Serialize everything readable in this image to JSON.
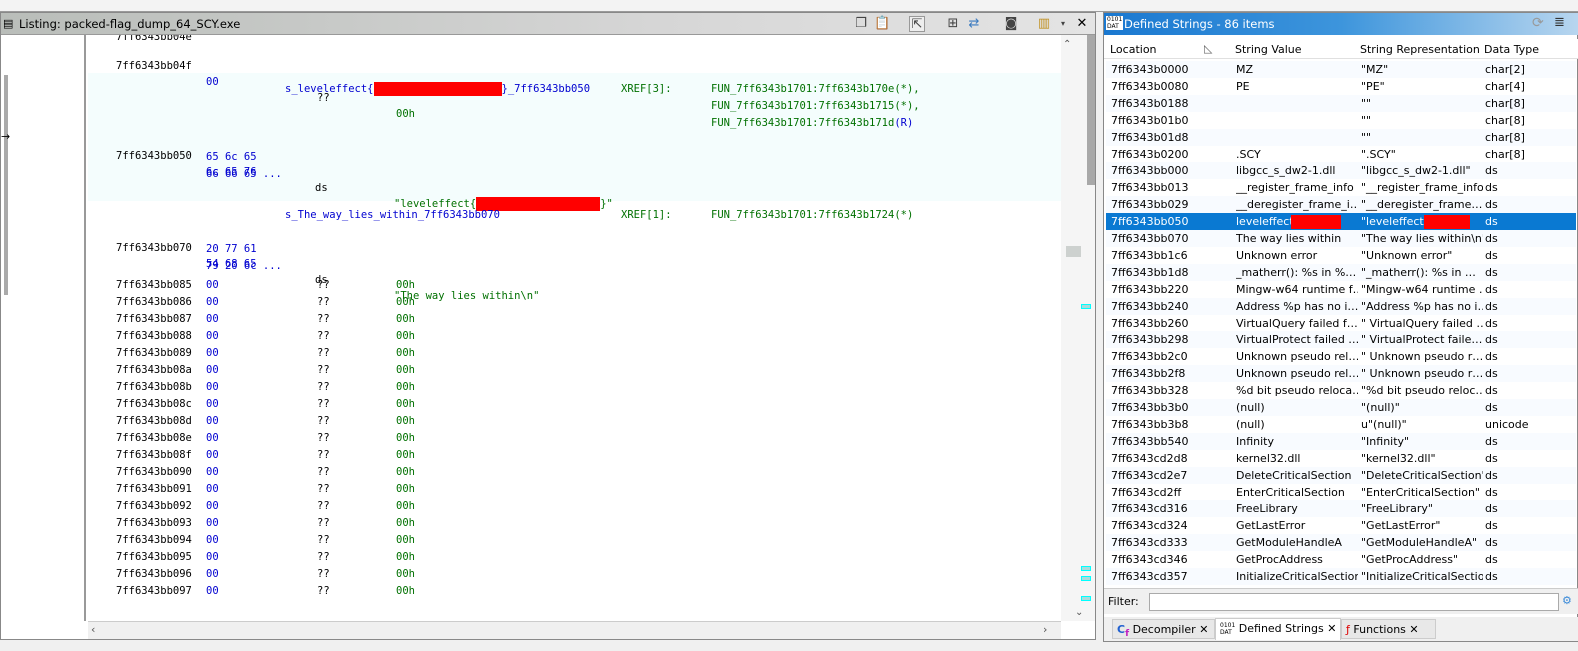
{
  "listing": {
    "title": "Listing:  packed-flag_dump_64_SCY.exe",
    "top_row": {
      "address": "7ff6343bb04f",
      "bytes": "00",
      "mnemonic": "??",
      "operand": "00h"
    },
    "label1": {
      "prefix": "s_leveleffect{",
      "suffix": "}_7ff6343bb050",
      "xref": "XREF[3]:",
      "refs": [
        "FUN_7ff6343b1701:7ff6343b170e(*),",
        "FUN_7ff6343b1701:7ff6343b1715(*),",
        "FUN_7ff6343b1701:7ff6343b171d"
      ],
      "last_ref_flag": "(R)"
    },
    "data1": {
      "address": "7ff6343bb050",
      "bytes": [
        "6c 65 76",
        "65 6c 65",
        "66 66 65 ..."
      ],
      "mnemonic": "ds",
      "operand_prefix": "\"leveleffect{",
      "operand_suffix": "}\""
    },
    "label2": {
      "name": "s_The_way_lies_within_7ff6343bb070",
      "xref": "XREF[1]:",
      "ref": "FUN_7ff6343b1701:7ff6343b1724(*)"
    },
    "data2": {
      "address": "7ff6343bb070",
      "bytes": [
        "54 68 65",
        "20 77 61",
        "79 20 6c ..."
      ],
      "mnemonic": "ds",
      "operand": "\"The way lies within\\n\""
    },
    "undefined_rows": [
      "7ff6343bb085",
      "7ff6343bb086",
      "7ff6343bb087",
      "7ff6343bb088",
      "7ff6343bb089",
      "7ff6343bb08a",
      "7ff6343bb08b",
      "7ff6343bb08c",
      "7ff6343bb08d",
      "7ff6343bb08e",
      "7ff6343bb08f",
      "7ff6343bb090",
      "7ff6343bb091",
      "7ff6343bb092",
      "7ff6343bb093",
      "7ff6343bb094",
      "7ff6343bb095",
      "7ff6343bb096",
      "7ff6343bb097"
    ],
    "undefined_bytes": "00",
    "undefined_mnemonic": "??",
    "undefined_operand": "00h"
  },
  "strings": {
    "title": "Defined Strings - 86 items",
    "columns": [
      "Location",
      "String Value",
      "String Representation",
      "Data Type"
    ],
    "rows": [
      [
        "7ff6343b0000",
        "MZ",
        "\"MZ\"",
        "char[2]"
      ],
      [
        "7ff6343b0080",
        "PE",
        "\"PE\"",
        "char[4]"
      ],
      [
        "7ff6343b0188",
        "",
        "\"\"",
        "char[8]"
      ],
      [
        "7ff6343b01b0",
        "",
        "\"\"",
        "char[8]"
      ],
      [
        "7ff6343b01d8",
        "",
        "\"\"",
        "char[8]"
      ],
      [
        "7ff6343b0200",
        ".SCY",
        "\".SCY\"",
        "char[8]"
      ],
      [
        "7ff6343bb000",
        "libgcc_s_dw2-1.dll",
        "\"libgcc_s_dw2-1.dll\"",
        "ds"
      ],
      [
        "7ff6343bb013",
        "__register_frame_info",
        "\"__register_frame_info\"",
        "ds"
      ],
      [
        "7ff6343bb029",
        "__deregister_frame_i…",
        "\"__deregister_frame…",
        "ds"
      ],
      [
        "7ff6343bb050",
        "leveleffect{",
        "\"leveleffect{",
        "ds"
      ],
      [
        "7ff6343bb070",
        "The way lies within",
        "\"The way lies within\\n\"",
        "ds"
      ],
      [
        "7ff6343bb1c6",
        "Unknown error",
        "\"Unknown error\"",
        "ds"
      ],
      [
        "7ff6343bb1d8",
        "_matherr(): %s in %…",
        "\"_matherr(): %s in …",
        "ds"
      ],
      [
        "7ff6343bb220",
        "Mingw-w64 runtime f…",
        "\"Mingw-w64 runtime …",
        "ds"
      ],
      [
        "7ff6343bb240",
        "Address %p has no i…",
        "\"Address %p has no i…",
        "ds"
      ],
      [
        "7ff6343bb260",
        "  VirtualQuery failed f…",
        "\"  VirtualQuery failed …",
        "ds"
      ],
      [
        "7ff6343bb298",
        "  VirtualProtect failed …",
        "\"  VirtualProtect faile…",
        "ds"
      ],
      [
        "7ff6343bb2c0",
        "  Unknown pseudo rel…",
        "\"  Unknown pseudo r…",
        "ds"
      ],
      [
        "7ff6343bb2f8",
        "  Unknown pseudo rel…",
        "\"  Unknown pseudo r…",
        "ds"
      ],
      [
        "7ff6343bb328",
        "%d bit pseudo reloca…",
        "\"%d bit pseudo reloc…",
        "ds"
      ],
      [
        "7ff6343bb3b0",
        "(null)",
        "\"(null)\"",
        "ds"
      ],
      [
        "7ff6343bb3b8",
        "(null)",
        "u\"(null)\"",
        "unicode"
      ],
      [
        "7ff6343bb540",
        "Infinity",
        "\"Infinity\"",
        "ds"
      ],
      [
        "7ff6343cd2d8",
        "kernel32.dll",
        "\"kernel32.dll\"",
        "ds"
      ],
      [
        "7ff6343cd2e7",
        "DeleteCriticalSection",
        "\"DeleteCriticalSection\"",
        "ds"
      ],
      [
        "7ff6343cd2ff",
        "EnterCriticalSection",
        "\"EnterCriticalSection\"",
        "ds"
      ],
      [
        "7ff6343cd316",
        "FreeLibrary",
        "\"FreeLibrary\"",
        "ds"
      ],
      [
        "7ff6343cd324",
        "GetLastError",
        "\"GetLastError\"",
        "ds"
      ],
      [
        "7ff6343cd333",
        "GetModuleHandleA",
        "\"GetModuleHandleA\"",
        "ds"
      ],
      [
        "7ff6343cd346",
        "GetProcAddress",
        "\"GetProcAddress\"",
        "ds"
      ],
      [
        "7ff6343cd357",
        "InitializeCriticalSection",
        "\"InitializeCriticalSection\"",
        "ds"
      ]
    ],
    "selected_index": 9,
    "filter_label": "Filter:",
    "filter_value": "",
    "tabs": [
      {
        "label": "Decompiler",
        "icon": "decompiler-icon"
      },
      {
        "label": "Defined Strings",
        "icon": "dat-icon",
        "active": true
      },
      {
        "label": "Functions",
        "icon": "functions-icon"
      }
    ]
  },
  "colors": {
    "selection": "#0a79d2",
    "redaction": "#ff0000",
    "address_bytes": "#0000d0",
    "operand": "#007000"
  }
}
